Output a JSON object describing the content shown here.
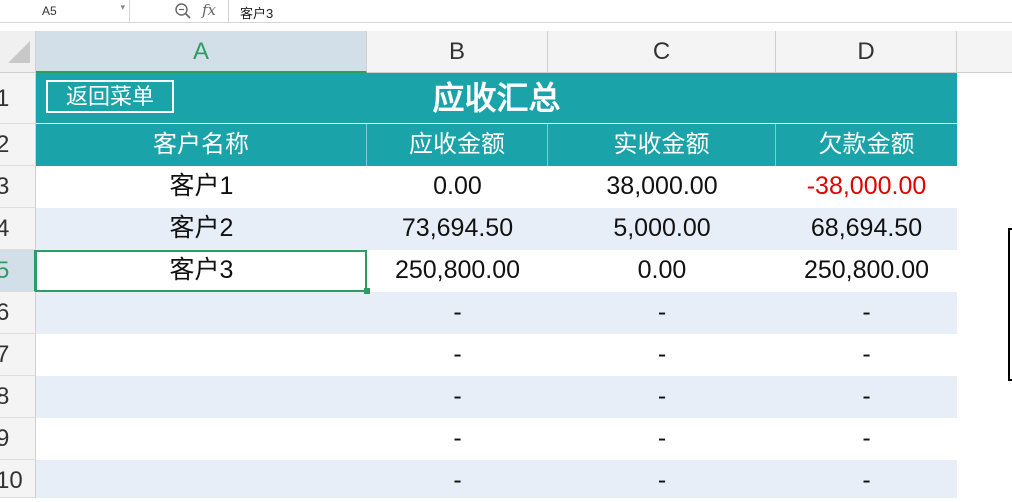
{
  "formula_bar": {
    "cell_ref": "A5",
    "fx_label": "fx",
    "value": "客户3"
  },
  "columns": [
    "A",
    "B",
    "C",
    "D"
  ],
  "rows": [
    "1",
    "2",
    "3",
    "4",
    "5",
    "6",
    "7",
    "8",
    "9",
    "10"
  ],
  "sheet": {
    "title": "应收汇总",
    "menu_button": "返回菜单",
    "headers": [
      "客户名称",
      "应收金额",
      "实收金额",
      "欠款金额"
    ],
    "data": [
      [
        "客户1",
        "0.00",
        "38,000.00",
        "-38,000.00"
      ],
      [
        "客户2",
        "73,694.50",
        "5,000.00",
        "68,694.50"
      ],
      [
        "客户3",
        "250,800.00",
        "0.00",
        "250,800.00"
      ],
      [
        "",
        "-",
        "-",
        "-"
      ],
      [
        "",
        "-",
        "-",
        "-"
      ],
      [
        "",
        "-",
        "-",
        "-"
      ],
      [
        "",
        "-",
        "-",
        "-"
      ],
      [
        "",
        "-",
        "-",
        "-"
      ]
    ]
  },
  "colors": {
    "header_teal": "#1aa3a8",
    "band_blue": "#e8eef7",
    "selection_green": "#2e9c63",
    "negative_red": "#e00000"
  }
}
